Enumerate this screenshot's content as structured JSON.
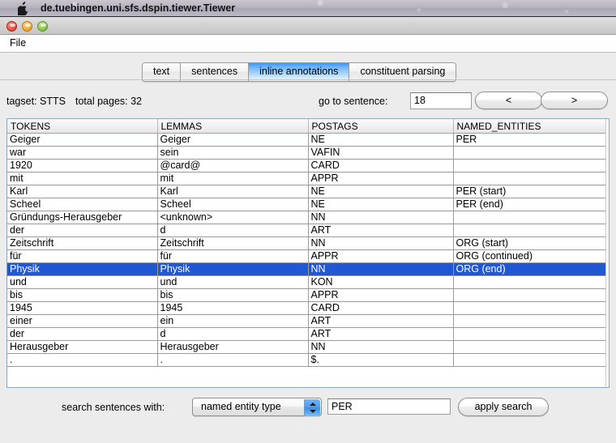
{
  "menubar": {
    "apple_icon": "apple-logo",
    "title": "de.tuebingen.uni.sfs.dspin.tiewer.Tiewer"
  },
  "window_controls": {
    "close": "close-button",
    "minimize": "minimize-button",
    "maximize": "maximize-button"
  },
  "app_menu": {
    "items": [
      {
        "label": "File"
      }
    ]
  },
  "tabs": [
    {
      "label": "text",
      "selected": false
    },
    {
      "label": "sentences",
      "selected": false
    },
    {
      "label": "inline annotations",
      "selected": true
    },
    {
      "label": "constituent parsing",
      "selected": false
    }
  ],
  "info": {
    "tagset_label": "tagset: STTS",
    "total_pages_label": "total pages: 32",
    "goto_label": "go to sentence:",
    "goto_value": "18",
    "goto_placeholder": "",
    "prev_label": "<",
    "next_label": ">"
  },
  "table": {
    "columns": [
      "TOKENS",
      "LEMMAS",
      "POSTAGS",
      "NAMED_ENTITIES"
    ],
    "rows": [
      {
        "cells": [
          "Geiger",
          "Geiger",
          "NE",
          "PER"
        ],
        "selected": false
      },
      {
        "cells": [
          "war",
          "sein",
          "VAFIN",
          ""
        ],
        "selected": false
      },
      {
        "cells": [
          "1920",
          "@card@",
          "CARD",
          ""
        ],
        "selected": false
      },
      {
        "cells": [
          "mit",
          "mit",
          "APPR",
          ""
        ],
        "selected": false
      },
      {
        "cells": [
          "Karl",
          "Karl",
          "NE",
          "PER (start)"
        ],
        "selected": false
      },
      {
        "cells": [
          "Scheel",
          "Scheel",
          "NE",
          "PER (end)"
        ],
        "selected": false
      },
      {
        "cells": [
          "Gründungs-Herausgeber",
          "<unknown>",
          "NN",
          ""
        ],
        "selected": false
      },
      {
        "cells": [
          "der",
          "d",
          "ART",
          ""
        ],
        "selected": false
      },
      {
        "cells": [
          "Zeitschrift",
          "Zeitschrift",
          "NN",
          "ORG (start)"
        ],
        "selected": false
      },
      {
        "cells": [
          "für",
          "für",
          "APPR",
          "ORG (continued)"
        ],
        "selected": false
      },
      {
        "cells": [
          "Physik",
          "Physik",
          "NN",
          "ORG (end)"
        ],
        "selected": true
      },
      {
        "cells": [
          "und",
          "und",
          "KON",
          ""
        ],
        "selected": false
      },
      {
        "cells": [
          "bis",
          "bis",
          "APPR",
          ""
        ],
        "selected": false
      },
      {
        "cells": [
          "1945",
          "1945",
          "CARD",
          ""
        ],
        "selected": false
      },
      {
        "cells": [
          "einer",
          "ein",
          "ART",
          ""
        ],
        "selected": false
      },
      {
        "cells": [
          "der",
          "d",
          "ART",
          ""
        ],
        "selected": false
      },
      {
        "cells": [
          "Herausgeber",
          "Herausgeber",
          "NN",
          ""
        ],
        "selected": false
      },
      {
        "cells": [
          ".",
          ".",
          "$.",
          ""
        ],
        "selected": false
      }
    ]
  },
  "search": {
    "label": "search sentences with:",
    "select_value": "named entity type",
    "select_options": [
      "named entity type"
    ],
    "input_value": "PER",
    "input_placeholder": "",
    "apply_label": "apply search"
  },
  "colors": {
    "selection_blue": "#2156d4",
    "tab_selected_blue": "#66aff5",
    "pane_border": "#8aa8c4"
  }
}
